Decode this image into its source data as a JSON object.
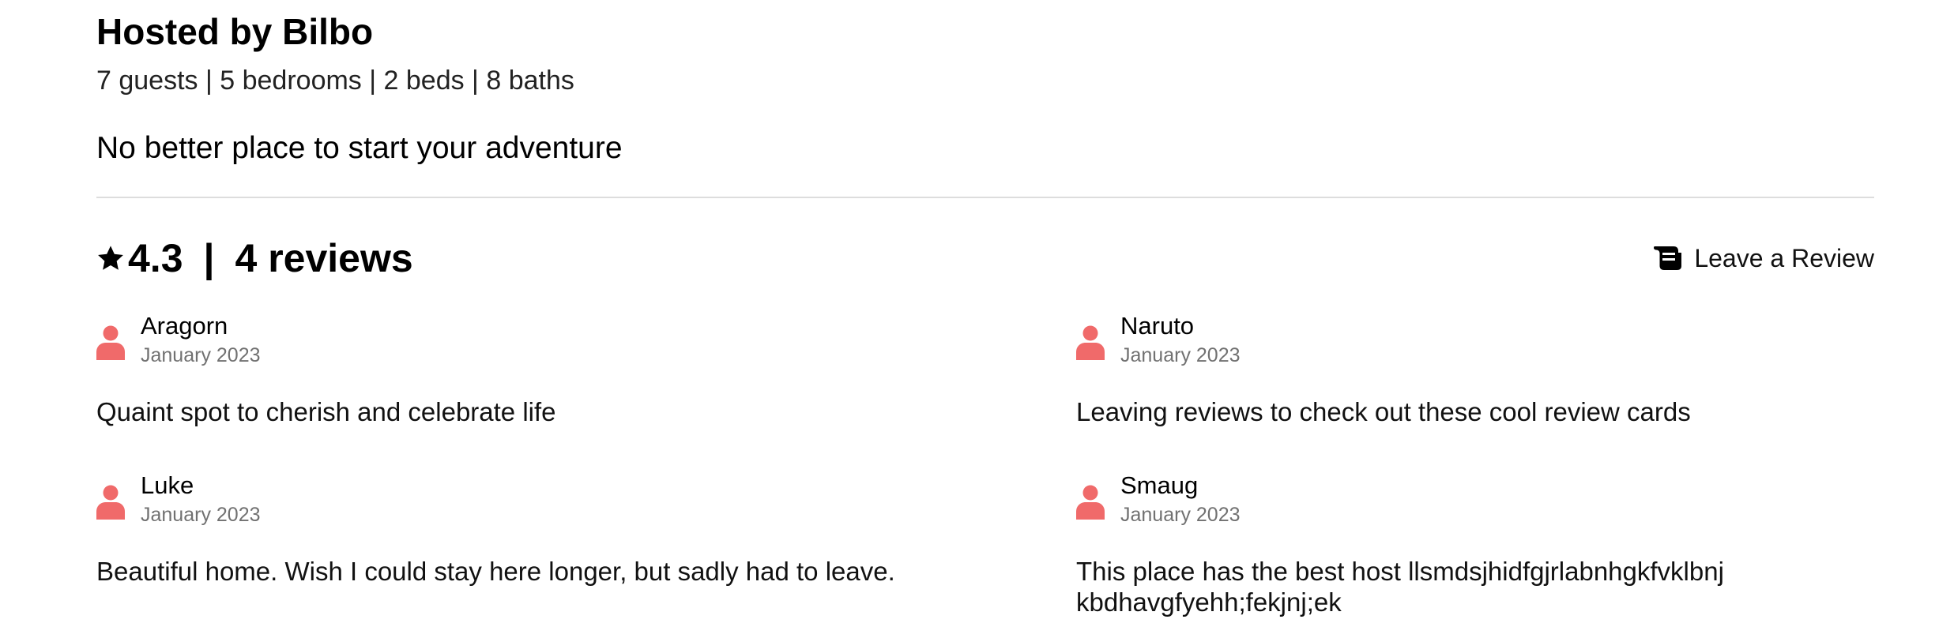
{
  "listing": {
    "host_title": "Hosted by Bilbo",
    "stats": "7 guests | 5 bedrooms | 2 beds | 8 baths",
    "description": "No better place to start your adventure"
  },
  "reviews_summary": {
    "star_icon": "star-icon",
    "rating": "4.3",
    "separator": "|",
    "count_label": "4 reviews",
    "leave_review_icon": "scroll-icon",
    "leave_review_label": "Leave a Review"
  },
  "colors": {
    "avatar": "#f06a6a",
    "date_text": "#717171",
    "divider": "#dddddd"
  },
  "reviews": [
    {
      "name": "Aragorn",
      "date": "January 2023",
      "text": "Quaint spot to cherish and celebrate life"
    },
    {
      "name": "Naruto",
      "date": "January 2023",
      "text": "Leaving reviews to check out these cool review cards"
    },
    {
      "name": "Luke",
      "date": "January 2023",
      "text": "Beautiful home. Wish I could stay here longer, but sadly had to leave."
    },
    {
      "name": "Smaug",
      "date": "January 2023",
      "text": "This place has the best host llsmdsjhidfgjrlabnhgkfvklbnjkbdhavgfyehh;fekjnj;ek"
    }
  ]
}
